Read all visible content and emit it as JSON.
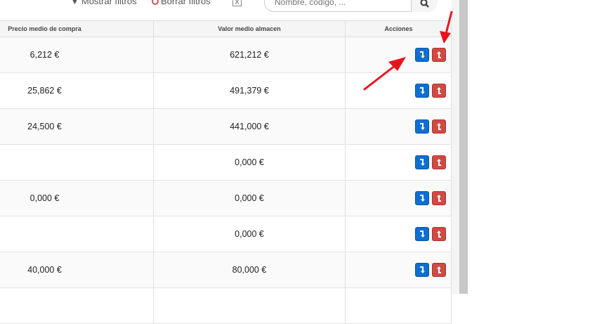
{
  "toolbar": {
    "filter_label": "Mostrar filtros",
    "clear_label": "Borrar filtros",
    "export_label": "X",
    "search_placeholder": "Nombre, código, ..."
  },
  "table": {
    "headers": {
      "avg_purchase_price": "Precio medio de compra",
      "avg_stock_value": "Valor medio almacen",
      "actions": "Acciones"
    },
    "rows": [
      {
        "price": "6,212 €",
        "value": "621,212 €"
      },
      {
        "price": "25,862 €",
        "value": "491,379 €"
      },
      {
        "price": "24,500 €",
        "value": "441,000 €"
      },
      {
        "price": "",
        "value": "0,000 €"
      },
      {
        "price": "0,000 €",
        "value": "0,000 €"
      },
      {
        "price": "",
        "value": "0,000 €"
      },
      {
        "price": "40,000 €",
        "value": "80,000 €"
      }
    ]
  },
  "icons": {
    "filter": "funnel-icon",
    "clear": "no-entry-icon",
    "export": "excel-icon",
    "search": "magnifier-icon",
    "stock_in": "arrow-down-right-icon",
    "stock_out": "arrow-up-icon"
  },
  "colors": {
    "stock_in_button": "#0d6fd1",
    "stock_out_button": "#d04a43",
    "annotation_arrow": "#e8141c"
  }
}
